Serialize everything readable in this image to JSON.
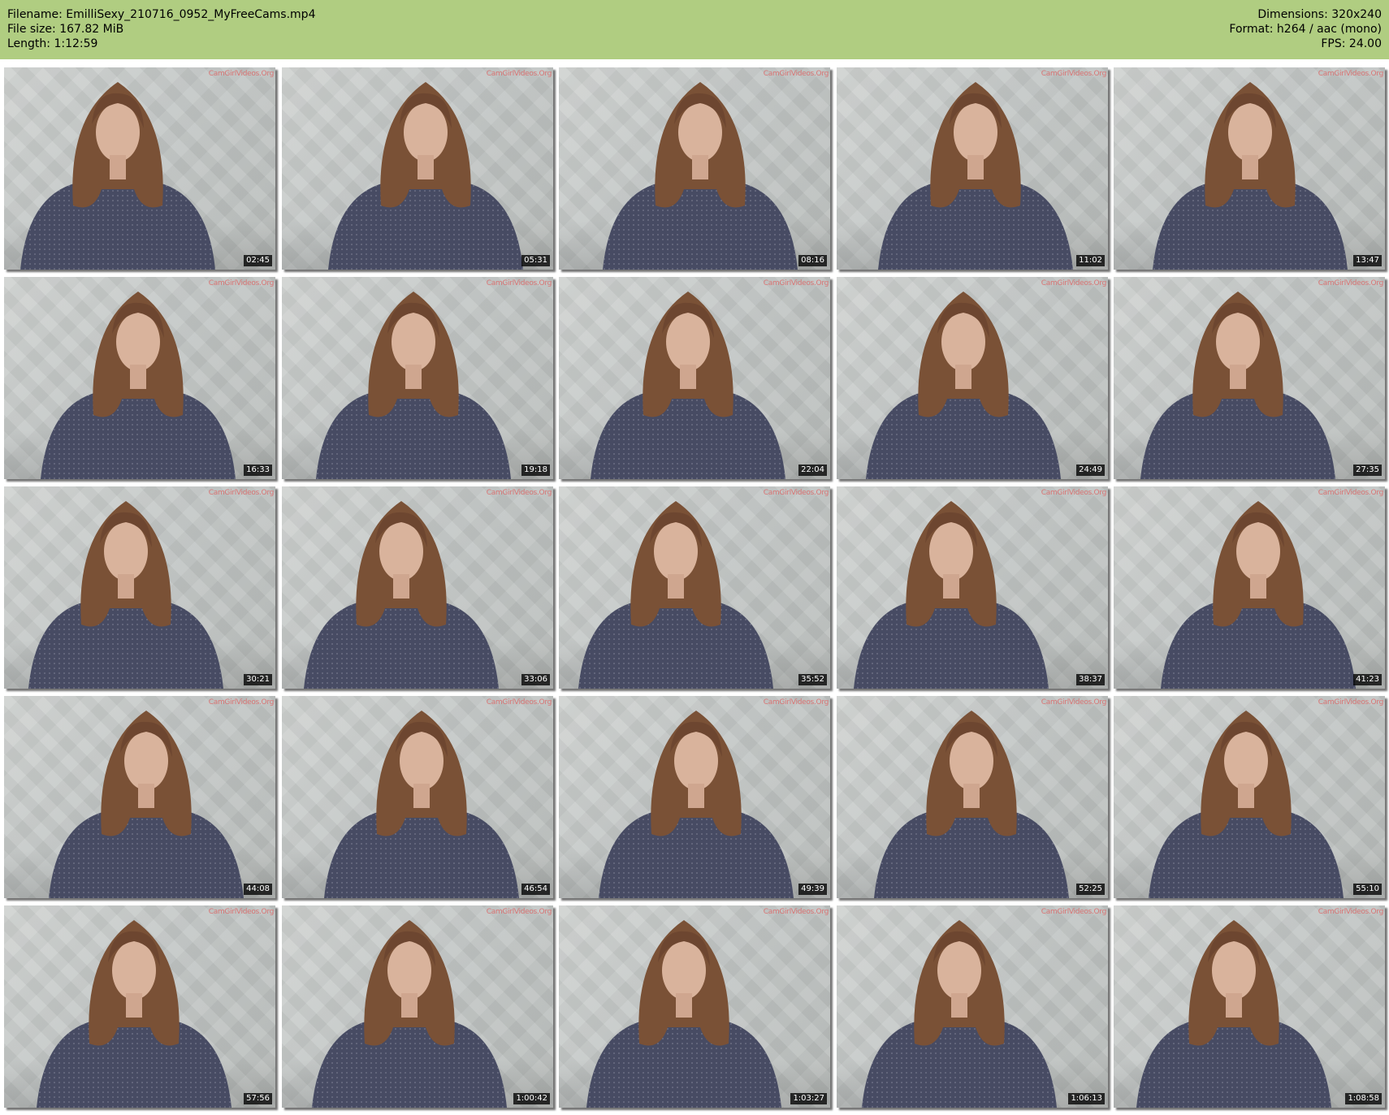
{
  "header": {
    "filename": "Filename: EmilliSexy_210716_0952_MyFreeCams.mp4",
    "filesize": "File size: 167.82 MiB",
    "length": "Length: 1:12:59",
    "dimensions": "Dimensions: 320x240",
    "format": "Format: h264 / aac (mono)",
    "fps": "FPS: 24.00"
  },
  "colors": {
    "header_bg": "#b0cd81",
    "page_bg": "#ffffff",
    "timestamp_bg": "#000000",
    "watermark": "#e15a5a"
  },
  "watermark_text": "CamGirlVideos.Org",
  "thumbnails": [
    {
      "timestamp": "02:45"
    },
    {
      "timestamp": "05:31"
    },
    {
      "timestamp": "08:16"
    },
    {
      "timestamp": "11:02"
    },
    {
      "timestamp": "13:47"
    },
    {
      "timestamp": "16:33"
    },
    {
      "timestamp": "19:18"
    },
    {
      "timestamp": "22:04"
    },
    {
      "timestamp": "24:49"
    },
    {
      "timestamp": "27:35"
    },
    {
      "timestamp": "30:21"
    },
    {
      "timestamp": "33:06"
    },
    {
      "timestamp": "35:52"
    },
    {
      "timestamp": "38:37"
    },
    {
      "timestamp": "41:23"
    },
    {
      "timestamp": "44:08"
    },
    {
      "timestamp": "46:54"
    },
    {
      "timestamp": "49:39"
    },
    {
      "timestamp": "52:25"
    },
    {
      "timestamp": "55:10"
    },
    {
      "timestamp": "57:56"
    },
    {
      "timestamp": "1:00:42"
    },
    {
      "timestamp": "1:03:27"
    },
    {
      "timestamp": "1:06:13"
    },
    {
      "timestamp": "1:08:58"
    }
  ]
}
